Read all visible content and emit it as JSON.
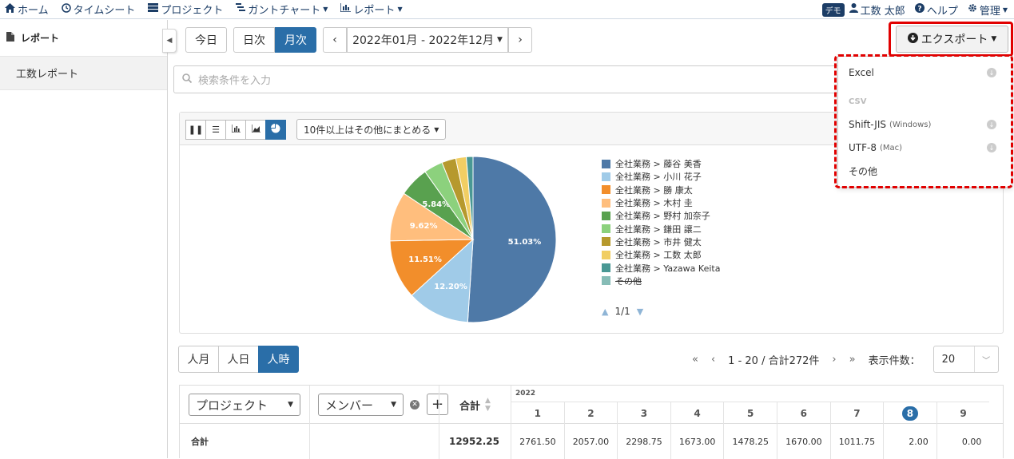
{
  "nav": {
    "items": [
      {
        "icon": "home-icon",
        "label": "ホーム"
      },
      {
        "icon": "clock-icon",
        "label": "タイムシート"
      },
      {
        "icon": "project-icon",
        "label": "プロジェクト"
      },
      {
        "icon": "gantt-icon",
        "label": "ガントチャート"
      },
      {
        "icon": "bar-chart-icon",
        "label": "レポート"
      }
    ],
    "demo_badge": "デモ",
    "user_name": "工数 太郎",
    "help": "ヘルプ",
    "admin": "管理"
  },
  "sidebar": {
    "title": "レポート",
    "items": [
      {
        "label": "工数レポート"
      }
    ]
  },
  "toolbar": {
    "today": "今日",
    "daily": "日次",
    "monthly": "月次",
    "period": "2022年01月 - 2022年12月",
    "export": "エクスポート"
  },
  "search": {
    "placeholder": "検索条件を入力"
  },
  "chart_controls": {
    "group_option": "10件以上はその他にまとめる"
  },
  "chart_data": {
    "type": "pie",
    "series": [
      {
        "name": "全社業務 > 藤谷 美香",
        "value": 51.03,
        "label": "51.03%",
        "color": "#4e79a7"
      },
      {
        "name": "全社業務 > 小川 花子",
        "value": 12.2,
        "label": "12.20%",
        "color": "#a0cbe8"
      },
      {
        "name": "全社業務 > 勝 康太",
        "value": 11.51,
        "label": "11.51%",
        "color": "#f28e2b"
      },
      {
        "name": "全社業務 > 木村 圭",
        "value": 9.62,
        "label": "9.62%",
        "color": "#ffbe7d"
      },
      {
        "name": "全社業務 > 野村 加奈子",
        "value": 5.84,
        "label": "5.84%",
        "color": "#59a14f"
      },
      {
        "name": "全社業務 > 鎌田 譲二",
        "value": 3.7,
        "label": "",
        "color": "#8cd17d"
      },
      {
        "name": "全社業務 > 市井 健太",
        "value": 2.75,
        "label": "",
        "color": "#b6992d"
      },
      {
        "name": "全社業務 > 工数 太郎",
        "value": 2.05,
        "label": "",
        "color": "#f1ce63"
      },
      {
        "name": "全社業務 > Yazawa Keita",
        "value": 1.3,
        "label": "",
        "color": "#499894"
      }
    ],
    "legend_extra": {
      "name": "その他",
      "color": "#86bcb6",
      "hidden": true
    },
    "legend_placement": "right",
    "legend_page": "1/1"
  },
  "units": {
    "man_month": "人月",
    "man_day": "人日",
    "man_hour": "人時"
  },
  "paging": {
    "info": "1 - 20 / 合計272件",
    "per_page_label": "表示件数：",
    "per_page": "20"
  },
  "table": {
    "project_select": "プロジェクト",
    "member_select": "メンバー",
    "total_header": "合計",
    "year": "2022",
    "months": [
      "1",
      "2",
      "3",
      "4",
      "5",
      "6",
      "7",
      "8",
      "9"
    ],
    "current_month": "8",
    "total_row": {
      "label": "合計",
      "total": "12952.25",
      "values": [
        "2761.50",
        "2057.00",
        "2298.75",
        "1673.00",
        "1478.25",
        "1670.00",
        "1011.75",
        "2.00",
        "0.00"
      ]
    }
  },
  "export_menu": {
    "excel": "Excel",
    "csv_header": "CSV",
    "shift_jis": "Shift-JIS",
    "shift_jis_note": "(Windows)",
    "utf8": "UTF-8",
    "utf8_note": "(Mac)",
    "other": "その他"
  }
}
